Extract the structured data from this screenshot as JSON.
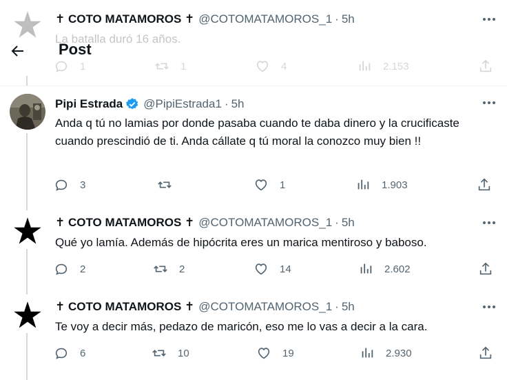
{
  "header": {
    "title": "Post"
  },
  "tweets": [
    {
      "name": "✝ COTO MATAMOROS ✝",
      "handle": "@COTOMATAMOROS_1",
      "time": "5h",
      "text": "La batalla duró 16 años.",
      "replies": "1",
      "reposts": "1",
      "likes": "4",
      "views": "2.153",
      "avatar": "star-icon"
    },
    {
      "name": "Pipi Estrada",
      "handle": "@PipiEstrada1",
      "time": "5h",
      "verified": true,
      "text": "Anda q tú no lamias por donde pasaba cuando te daba dinero y la crucificaste cuando prescindió de ti. Anda cállate q tú moral la conozco muy bien !!",
      "replies": "3",
      "reposts": "",
      "likes": "1",
      "views": "1.903",
      "avatar": "photo"
    },
    {
      "name": "✝ COTO MATAMOROS ✝",
      "handle": "@COTOMATAMOROS_1",
      "time": "5h",
      "text": "Qué yo lamía. Además de hipócrita eres un marica mentiroso y baboso.",
      "replies": "2",
      "reposts": "2",
      "likes": "14",
      "views": "2.602",
      "avatar": "star-icon"
    },
    {
      "name": "✝ COTO MATAMOROS ✝",
      "handle": "@COTOMATAMOROS_1",
      "time": "5h",
      "text": "Te voy a decir más, pedazo de maricón, eso me lo vas a decir a la cara.",
      "replies": "6",
      "reposts": "10",
      "likes": "19",
      "views": "2.930",
      "avatar": "star-icon"
    }
  ],
  "colors": {
    "text": "#0f1419",
    "secondary": "#536471",
    "verified": "#1d9bf0",
    "line": "#cfd9de"
  }
}
